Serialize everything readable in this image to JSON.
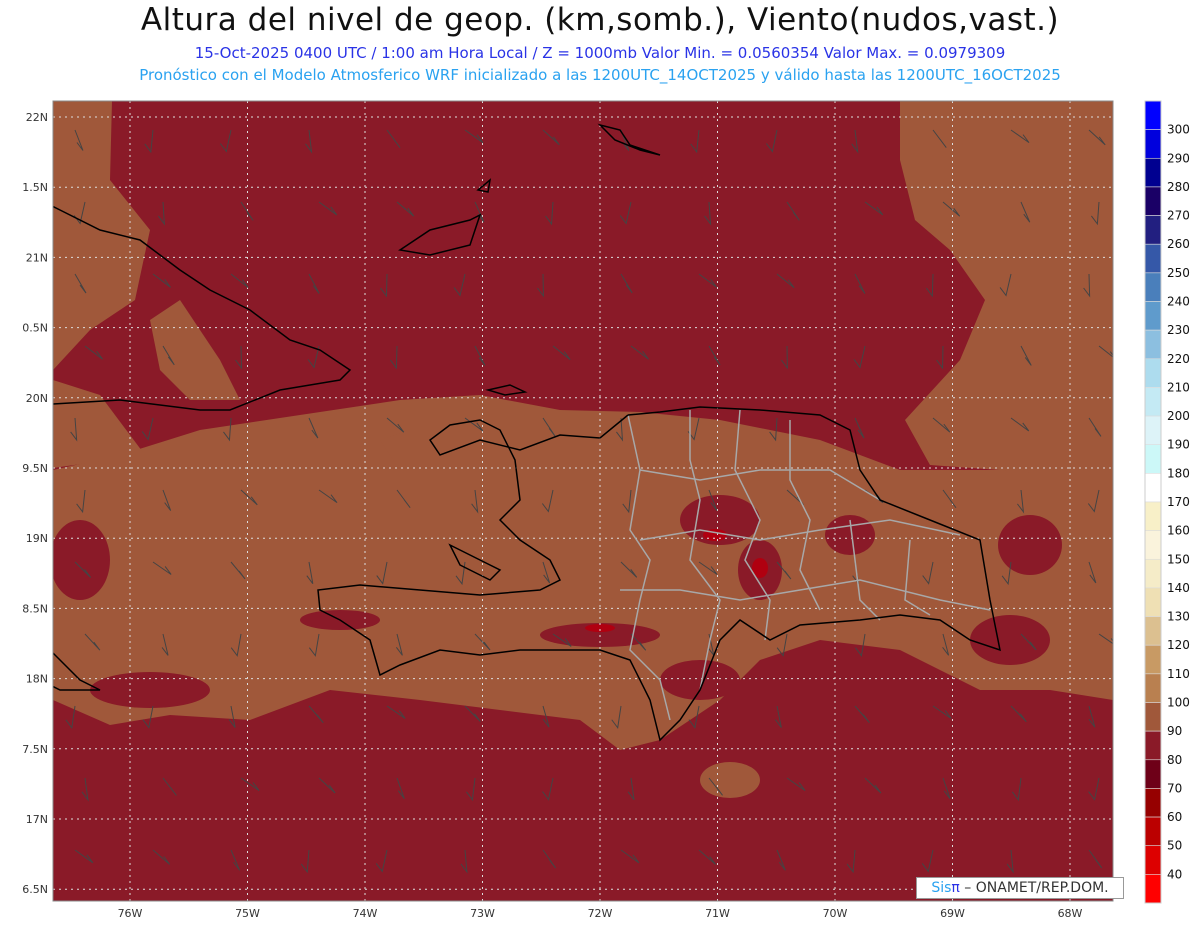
{
  "header": {
    "title": "Altura del nivel de geop. (km,somb.), Viento(nudos,vast.)",
    "subtitle_1": "15-Oct-2025  0400 UTC / 1:00 am Hora Local / Z = 1000mb Valor Min. = 0.0560354   Valor Max. = 0.0979309",
    "subtitle_2": "Pronóstico con el Modelo Atmosferico WRF inicializado a las 1200UTC_14OCT2025 y válido hasta las  1200UTC_16OCT2025"
  },
  "map": {
    "lon_labels": [
      "76W",
      "75W",
      "74W",
      "73W",
      "72W",
      "71W",
      "70W",
      "69W",
      "68W"
    ],
    "lat_labels": [
      "22N",
      "1.5N",
      "21N",
      "0.5N",
      "20N",
      "9.5N",
      "19N",
      "8.5N",
      "18N",
      "7.5N",
      "17N",
      "6.5N"
    ],
    "colors": {
      "low": "#8a1a28",
      "high": "#a0583a",
      "coast": "#000000",
      "provinces": "#a8a8a8"
    }
  },
  "colorbar": {
    "labels": [
      "300",
      "290",
      "280",
      "270",
      "260",
      "250",
      "240",
      "230",
      "220",
      "210",
      "200",
      "190",
      "180",
      "170",
      "160",
      "150",
      "140",
      "130",
      "120",
      "110",
      "100",
      "90",
      "80",
      "70",
      "60",
      "50",
      "40"
    ],
    "colors": [
      "#0000ff",
      "#0000dd",
      "#000090",
      "#1a0066",
      "#221f80",
      "#3558a8",
      "#4a7fbb",
      "#5f9bcc",
      "#8cbfe0",
      "#addcee",
      "#c4eaf4",
      "#ddf3f8",
      "#ccf8f8",
      "#ffffff",
      "#f8f0c8",
      "#faf3dc",
      "#f5ecc8",
      "#efe0b4",
      "#dcc090",
      "#c89a64",
      "#b98050",
      "#a0583a",
      "#8a1a28",
      "#6e0018",
      "#960000",
      "#bb0000",
      "#dd0000",
      "#ff0000"
    ]
  },
  "credit": {
    "sis": "Sis",
    "pi": "π",
    "rest": " –  ONAMET/REP.DOM."
  }
}
